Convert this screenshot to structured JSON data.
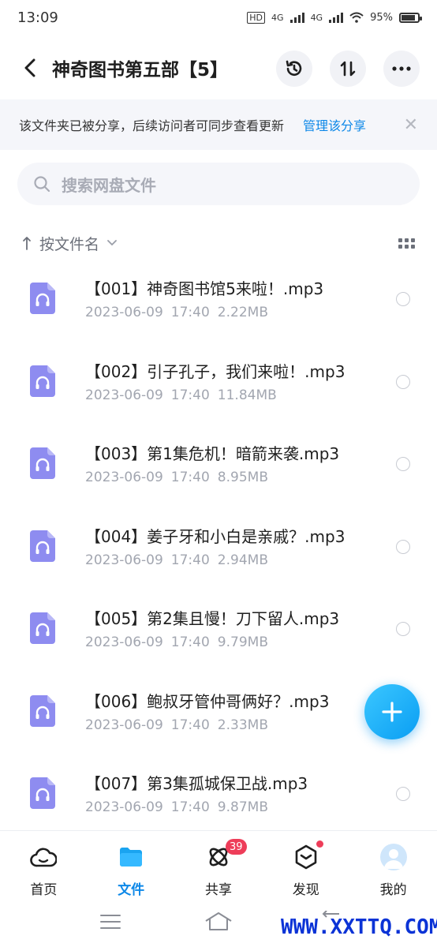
{
  "status_bar": {
    "time": "13:09",
    "network_1": "4G",
    "network_2": "4G",
    "hd_label": "HD",
    "battery": "95%"
  },
  "header": {
    "title": "神奇图书第五部【5】"
  },
  "share_banner": {
    "text": "该文件夹已被分享，后续访问者可同步查看更新",
    "link": "管理该分享"
  },
  "search": {
    "placeholder": "搜索网盘文件"
  },
  "sort": {
    "label": "按文件名"
  },
  "files": [
    {
      "name": "【001】神奇图书馆5来啦！.mp3",
      "date": "2023-06-09",
      "time": "17:40",
      "size": "2.22MB"
    },
    {
      "name": "【002】引子孔子，我们来啦！.mp3",
      "date": "2023-06-09",
      "time": "17:40",
      "size": "11.84MB"
    },
    {
      "name": "【003】第1集危机！暗箭来袭.mp3",
      "date": "2023-06-09",
      "time": "17:40",
      "size": "8.95MB"
    },
    {
      "name": "【004】姜子牙和小白是亲戚？.mp3",
      "date": "2023-06-09",
      "time": "17:40",
      "size": "2.94MB"
    },
    {
      "name": "【005】第2集且慢！刀下留人.mp3",
      "date": "2023-06-09",
      "time": "17:40",
      "size": "9.79MB"
    },
    {
      "name": "【006】鲍叔牙管仲哥俩好？.mp3",
      "date": "2023-06-09",
      "time": "17:40",
      "size": "2.33MB"
    },
    {
      "name": "【007】第3集孤城保卫战.mp3",
      "date": "2023-06-09",
      "time": "17:40",
      "size": "9.87MB"
    }
  ],
  "bottom_nav": {
    "home": "首页",
    "files": "文件",
    "share": "共享",
    "share_badge": "39",
    "discover": "发现",
    "mine": "我的"
  },
  "watermark": "WWW.XXTTQ.COM",
  "colors": {
    "accent": "#0d88e8",
    "file_icon": "#8e8cf0",
    "badge": "#ee3d59"
  }
}
